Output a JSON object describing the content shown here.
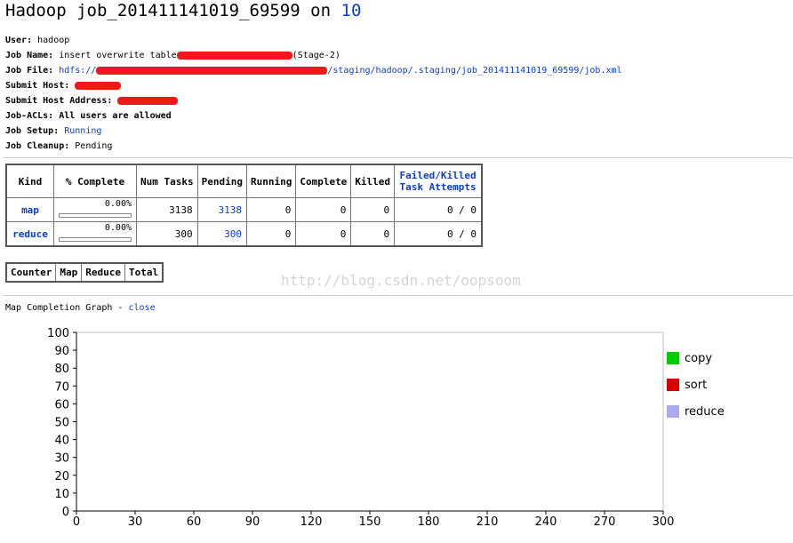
{
  "page": {
    "title_prefix": "Hadoop job_201411141019_69599 on",
    "title_host": "10"
  },
  "info": {
    "user_label": "User:",
    "user_value": "hadoop",
    "job_name_label": "Job Name:",
    "job_name_value": "insert overwrite table",
    "job_name_suffix": "(Stage-2)",
    "job_file_label": "Job File:",
    "job_file_prefix": "hdfs://",
    "job_file_suffix": "/staging/hadoop/.staging/job_201411141019_69599/job.xml",
    "submit_host_label": "Submit Host:",
    "submit_host_address_label": "Submit Host Address:",
    "acls_label": "Job-ACLs:",
    "acls_value": "All users are allowed",
    "setup_label": "Job Setup:",
    "setup_value": "Running",
    "cleanup_label": "Job Cleanup:",
    "cleanup_value": "Pending"
  },
  "job_table": {
    "headers": [
      "Kind",
      "% Complete",
      "Num Tasks",
      "Pending",
      "Running",
      "Complete",
      "Killed",
      "Failed/Killed Task Attempts"
    ],
    "failed_header_line1": "Failed/Killed",
    "failed_header_line2": "Task Attempts",
    "rows": [
      {
        "kind": "map",
        "complete": "0.00%",
        "progress": 0,
        "num_tasks": "3138",
        "pending": "3138",
        "running": "0",
        "completed": "0",
        "killed": "0",
        "failed": "0 / 0"
      },
      {
        "kind": "reduce",
        "complete": "0.00%",
        "progress": 0,
        "num_tasks": "300",
        "pending": "300",
        "running": "0",
        "completed": "0",
        "killed": "0",
        "failed": "0 / 0"
      }
    ]
  },
  "counter_table": {
    "headers": [
      "Counter",
      "Map",
      "Reduce",
      "Total"
    ]
  },
  "watermark": "http://blog.csdn.net/oopsoom",
  "graph": {
    "label": "Map Completion Graph -",
    "close_link": "close"
  },
  "chart_data": {
    "type": "line",
    "xlim": [
      0,
      300
    ],
    "ylim": [
      0,
      100
    ],
    "x_ticks": [
      "0",
      "30",
      "60",
      "90",
      "120",
      "150",
      "180",
      "210",
      "240",
      "270",
      "300"
    ],
    "y_ticks": [
      "0",
      "10",
      "20",
      "30",
      "40",
      "50",
      "60",
      "70",
      "80",
      "90",
      "100"
    ],
    "series": [
      {
        "name": "copy",
        "color": "#00cc00",
        "values": []
      },
      {
        "name": "sort",
        "color": "#dd0000",
        "values": []
      },
      {
        "name": "reduce",
        "color": "#aaaaee",
        "values": []
      }
    ],
    "legend_position": "right"
  }
}
